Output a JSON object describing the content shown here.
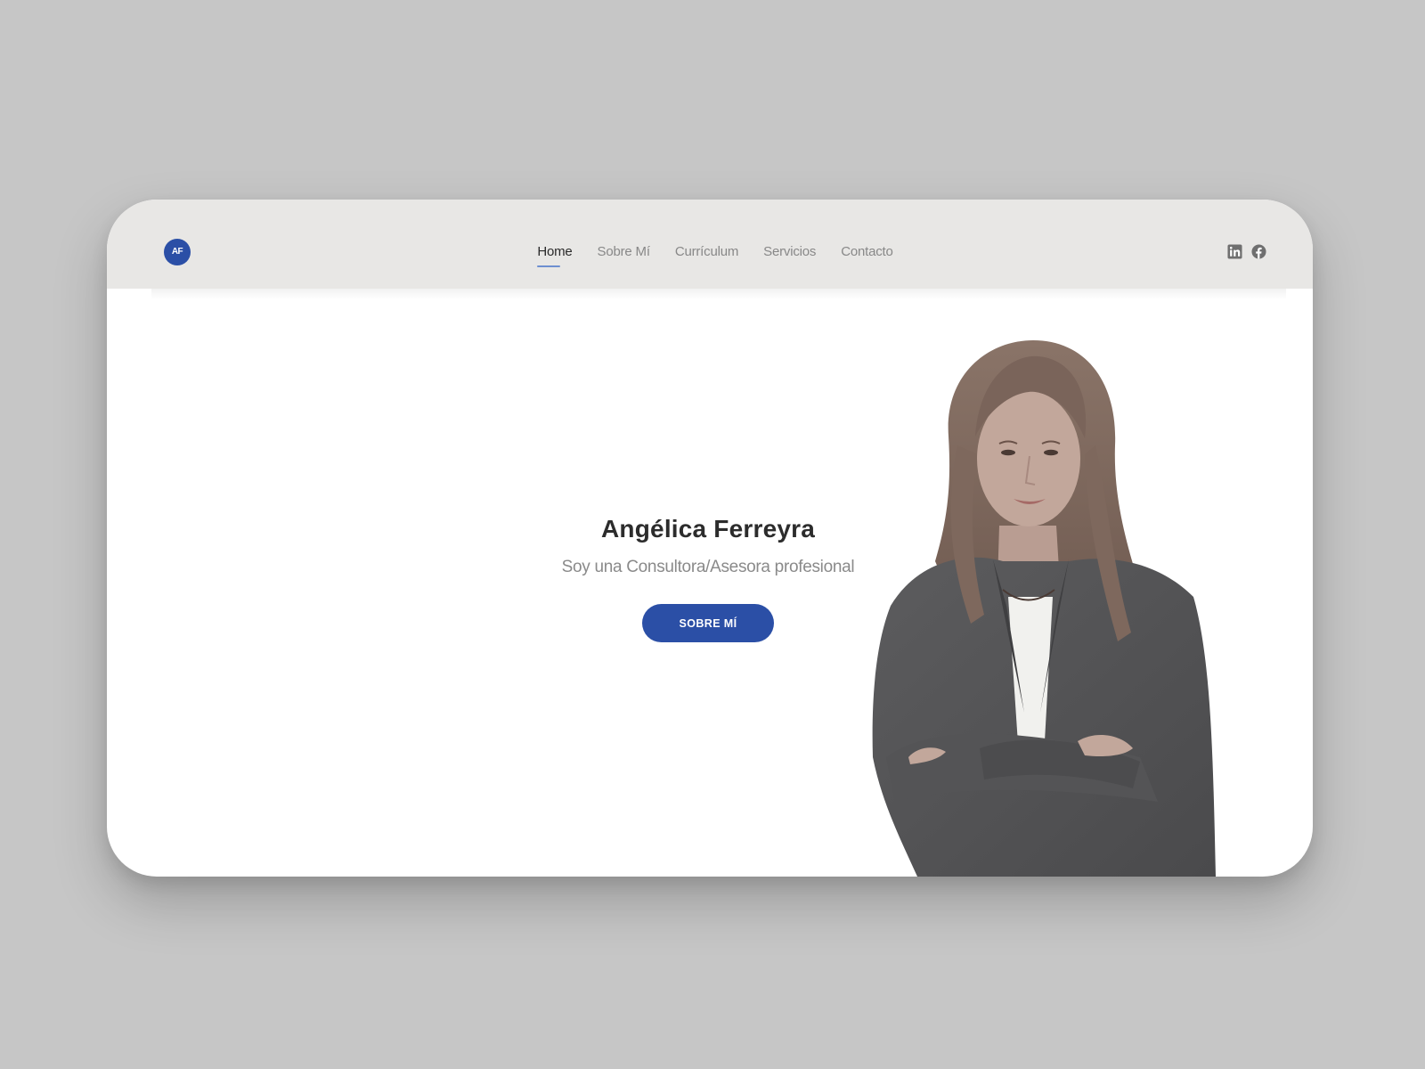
{
  "navbar": {
    "logo_text": "AF",
    "links": [
      {
        "label": "Home",
        "active": true
      },
      {
        "label": "Sobre Mí",
        "active": false
      },
      {
        "label": "Currículum",
        "active": false
      },
      {
        "label": "Servicios",
        "active": false
      },
      {
        "label": "Contacto",
        "active": false
      }
    ],
    "social_icons": [
      "linkedin-icon",
      "facebook-icon"
    ]
  },
  "hero": {
    "name": "Angélica Ferreyra",
    "subtitle": "Soy una Consultora/Asesora profesional",
    "button_label": "SOBRE MÍ"
  },
  "colors": {
    "accent": "#2b4fa6",
    "navbar_bg": "#e8e7e5",
    "page_bg": "#c6c6c6"
  }
}
